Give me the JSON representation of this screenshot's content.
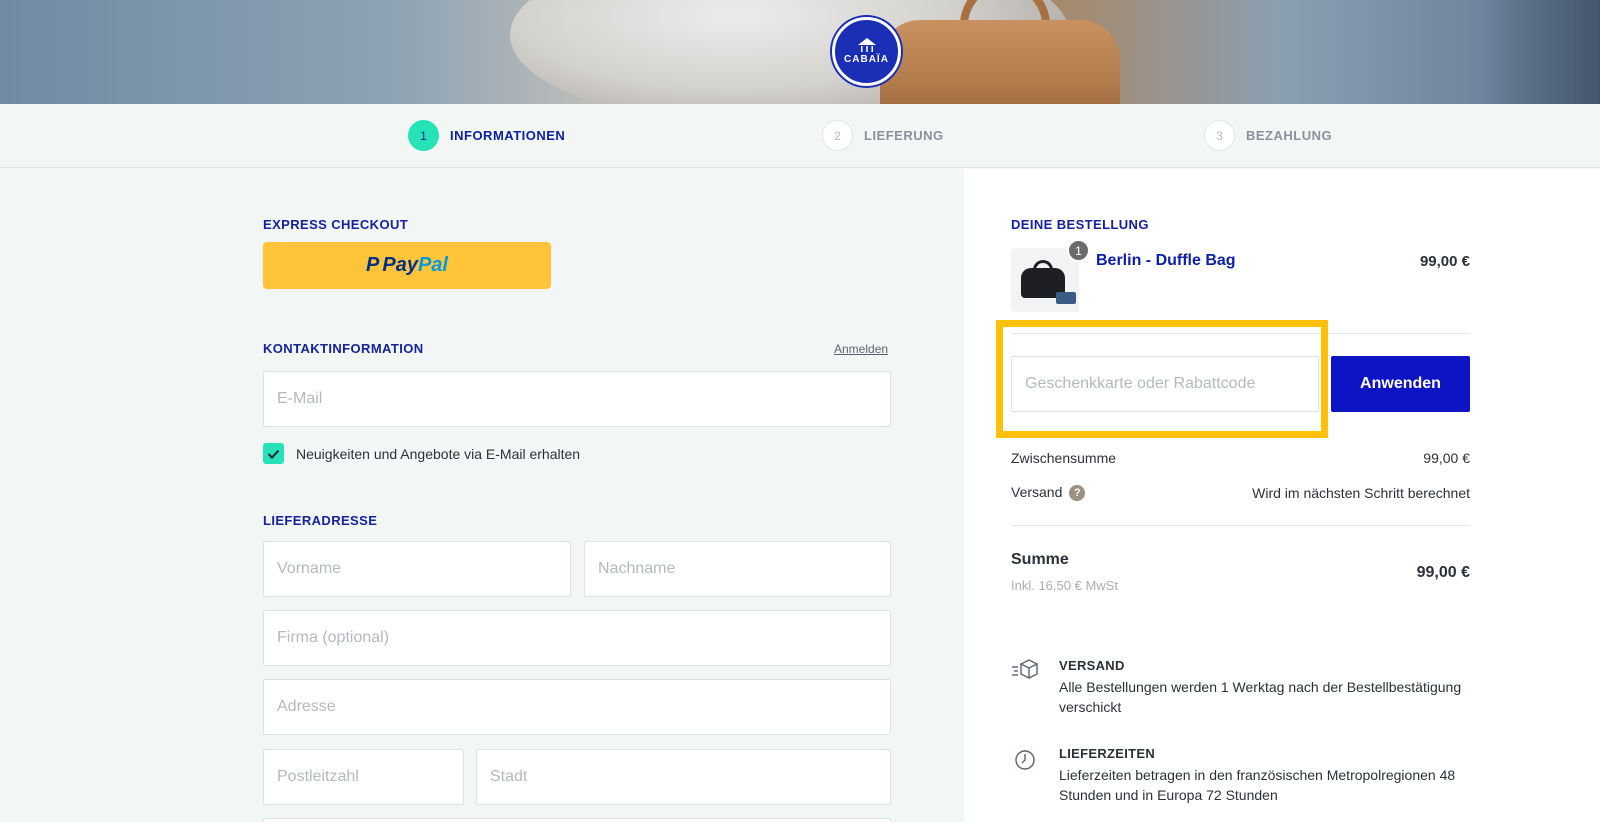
{
  "brand": {
    "logo_text": "CABAÏA"
  },
  "steps": [
    {
      "num": "1",
      "label": "INFORMATIONEN",
      "active": true
    },
    {
      "num": "2",
      "label": "LIEFERUNG",
      "active": false
    },
    {
      "num": "3",
      "label": "BEZAHLUNG",
      "active": false
    }
  ],
  "express": {
    "title": "EXPRESS CHECKOUT",
    "paypal_a": "Pay",
    "paypal_b": "Pal"
  },
  "contact": {
    "title": "KONTAKTINFORMATION",
    "login_link": "Anmelden",
    "email_placeholder": "E-Mail",
    "newsletter_label": "Neuigkeiten und Angebote via E-Mail erhalten",
    "newsletter_checked": true
  },
  "shipping_address": {
    "title": "LIEFERADRESSE",
    "first_name_placeholder": "Vorname",
    "last_name_placeholder": "Nachname",
    "company_placeholder": "Firma (optional)",
    "address_placeholder": "Adresse",
    "postal_placeholder": "Postleitzahl",
    "city_placeholder": "Stadt"
  },
  "order": {
    "title": "DEINE BESTELLUNG",
    "item": {
      "name": "Berlin - Duffle Bag",
      "price": "99,00 €",
      "qty": "1"
    },
    "discount_placeholder": "Geschenkkarte oder Rabattcode",
    "apply_label": "Anwenden",
    "subtotal_label": "Zwischensumme",
    "subtotal_value": "99,00 €",
    "shipping_label": "Versand",
    "shipping_value": "Wird im nächsten Schritt berechnet",
    "total_label": "Summe",
    "total_sub": "Inkl. 16,50 € MwSt",
    "total_value": "99,00 €"
  },
  "info": [
    {
      "icon": "package-icon",
      "title": "VERSAND",
      "text": "Alle Bestellungen werden 1 Werktag nach der Bestellbestätigung verschickt"
    },
    {
      "icon": "clock-icon",
      "title": "LIEFERZEITEN",
      "text": "Lieferzeiten betragen in den französischen Metropolregionen 48 Stunden und in Europa 72 Stunden"
    }
  ],
  "colors": {
    "accent": "#26e3b7",
    "primary": "#0b1ea8",
    "button": "#0d14c4",
    "paypal": "#ffc439",
    "highlight": "#ffc107"
  }
}
